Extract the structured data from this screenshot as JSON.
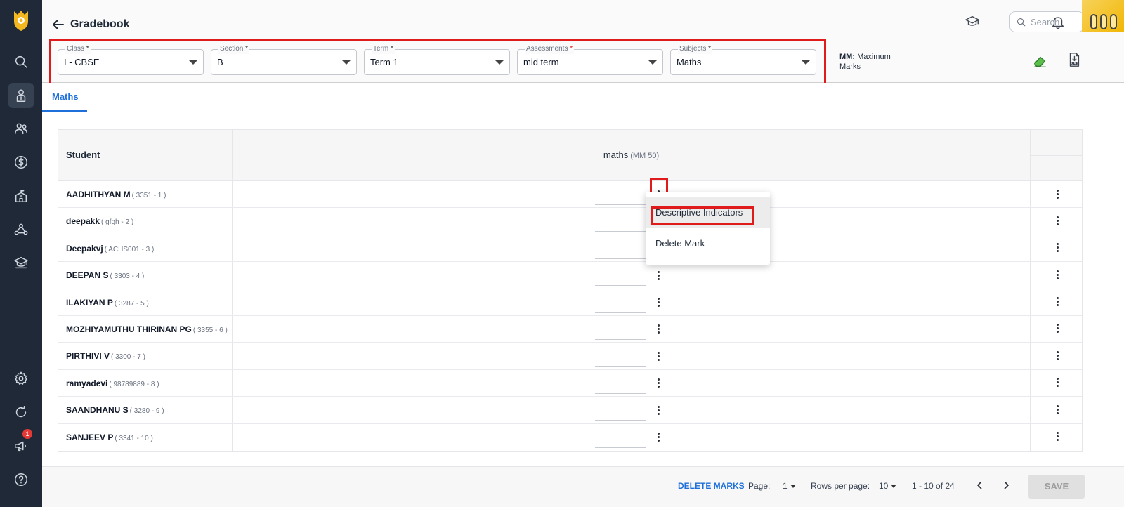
{
  "header": {
    "title": "Gradebook",
    "search_placeholder": "Search"
  },
  "filters": [
    {
      "label": "Class",
      "required": "*",
      "value": "I - CBSE"
    },
    {
      "label": "Section",
      "required": "*",
      "value": "B"
    },
    {
      "label": "Term",
      "required": "*",
      "value": "Term 1"
    },
    {
      "label": "Assessments",
      "required": "*",
      "value": "mid term"
    },
    {
      "label": "Subjects",
      "required": "*",
      "value": "Maths"
    }
  ],
  "mm_note": {
    "abbr": "MM:",
    "text": "Maximum Marks"
  },
  "tabs": [
    {
      "label": "Maths"
    }
  ],
  "table": {
    "student_header": "Student",
    "subject_header": "maths",
    "subject_mm": "(MM 50)",
    "rows": [
      {
        "name": "AADHITHYAN M",
        "id": "( 3351 - 1 )"
      },
      {
        "name": "deepakk",
        "id": "( gfgh - 2 )"
      },
      {
        "name": "Deepakvj",
        "id": "( ACHS001 - 3 )"
      },
      {
        "name": "DEEPAN S",
        "id": "( 3303 - 4 )"
      },
      {
        "name": "ILAKIYAN P",
        "id": "( 3287 - 5 )"
      },
      {
        "name": "MOZHIYAMUTHU THIRINAN PG",
        "id": "( 3355 - 6 )"
      },
      {
        "name": "PIRTHIVI V",
        "id": "( 3300 - 7 )"
      },
      {
        "name": "ramyadevi",
        "id": "( 98789889 - 8 )"
      },
      {
        "name": "SAANDHANU S",
        "id": "( 3280 - 9 )"
      },
      {
        "name": "SANJEEV P",
        "id": "( 3341 - 10 )"
      }
    ]
  },
  "context_menu": {
    "items": [
      {
        "label": "Descriptive Indicators"
      },
      {
        "label": "Delete Mark"
      }
    ]
  },
  "footer": {
    "delete_marks": "DELETE MARKS",
    "page_label": "Page:",
    "page_value": "1",
    "rows_label": "Rows per page:",
    "rows_value": "10",
    "range": "1 - 10 of 24",
    "save": "SAVE"
  },
  "sidebar": {
    "notification_badge": "1",
    "items": [
      "search-icon",
      "student-icon",
      "users-icon",
      "fees-icon",
      "school-icon",
      "network-icon",
      "graduation-icon",
      "settings-icon",
      "refresh-icon",
      "megaphone-icon",
      "help-icon"
    ]
  },
  "colors": {
    "sidebar_bg": "#1f2937",
    "accent": "#1e6fd9",
    "highlight_outline": "#e01b1b"
  }
}
